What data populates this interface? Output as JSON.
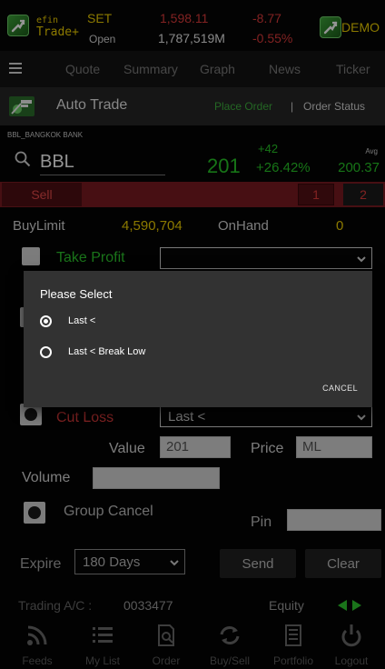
{
  "market": {
    "logo_line1": "efin",
    "logo_line2": "Trade+",
    "index_name": "SET",
    "index_value": "1,598.11",
    "index_change": "-8.77",
    "session": "Open",
    "volume": "1,787,519M",
    "pct_change": "-0.55%",
    "demo_label": "DEMO"
  },
  "menu": {
    "items": [
      {
        "label": "Quote"
      },
      {
        "label": "Summary"
      },
      {
        "label": "Graph"
      },
      {
        "label": "News"
      },
      {
        "label": "Ticker"
      }
    ]
  },
  "auto_trade": {
    "title": "Auto Trade",
    "place_order": "Place Order",
    "separator": "|",
    "order_status": "Order Status"
  },
  "stock": {
    "name": "BBL_BANGKOK BANK",
    "symbol": "BBL",
    "price": "201",
    "change": "+42",
    "pct": "+26.42%",
    "avg_label": "Avg",
    "avg_value": "200.37"
  },
  "side": {
    "label": "Sell",
    "btn1": "1",
    "btn2": "2"
  },
  "limits": {
    "buy_limit_label": "BuyLimit",
    "buy_limit_value": "4,590,704",
    "onhand_label": "OnHand",
    "onhand_value": "0"
  },
  "form": {
    "take_profit_label": "Take Profit",
    "cut_loss_label": "Cut Loss",
    "cut_loss_value": "Last <",
    "value_label": "Value",
    "value_field": "201",
    "price_label": "Price",
    "price_field": "ML",
    "volume_label": "Volume",
    "group_cancel_label": "Group Cancel",
    "pin_label": "Pin",
    "expire_label": "Expire",
    "expire_value": "180 Days",
    "send_label": "Send",
    "clear_label": "Clear"
  },
  "dialog": {
    "title": "Please Select",
    "options": [
      {
        "label": "Last <",
        "selected": true
      },
      {
        "label": "Last < Break Low",
        "selected": false
      }
    ],
    "cancel_label": "CANCEL"
  },
  "account": {
    "label": "Trading A/C :",
    "number": "0033477",
    "equity_label": "Equity"
  },
  "tabbar": {
    "tabs": [
      {
        "label": "Feeds",
        "icon": "feeds-icon"
      },
      {
        "label": "My List",
        "icon": "list-icon"
      },
      {
        "label": "Order",
        "icon": "order-icon"
      },
      {
        "label": "Buy/Sell",
        "icon": "buy-sell-icon"
      },
      {
        "label": "Portfolio",
        "icon": "portfolio-icon"
      },
      {
        "label": "Logout",
        "icon": "power-icon"
      }
    ]
  },
  "colors": {
    "background": "#040404",
    "green": "#28c828",
    "red": "#e03c3c",
    "yellow": "#f0d000",
    "sell_bar": "#7a1b22",
    "dialog": "#323232"
  }
}
